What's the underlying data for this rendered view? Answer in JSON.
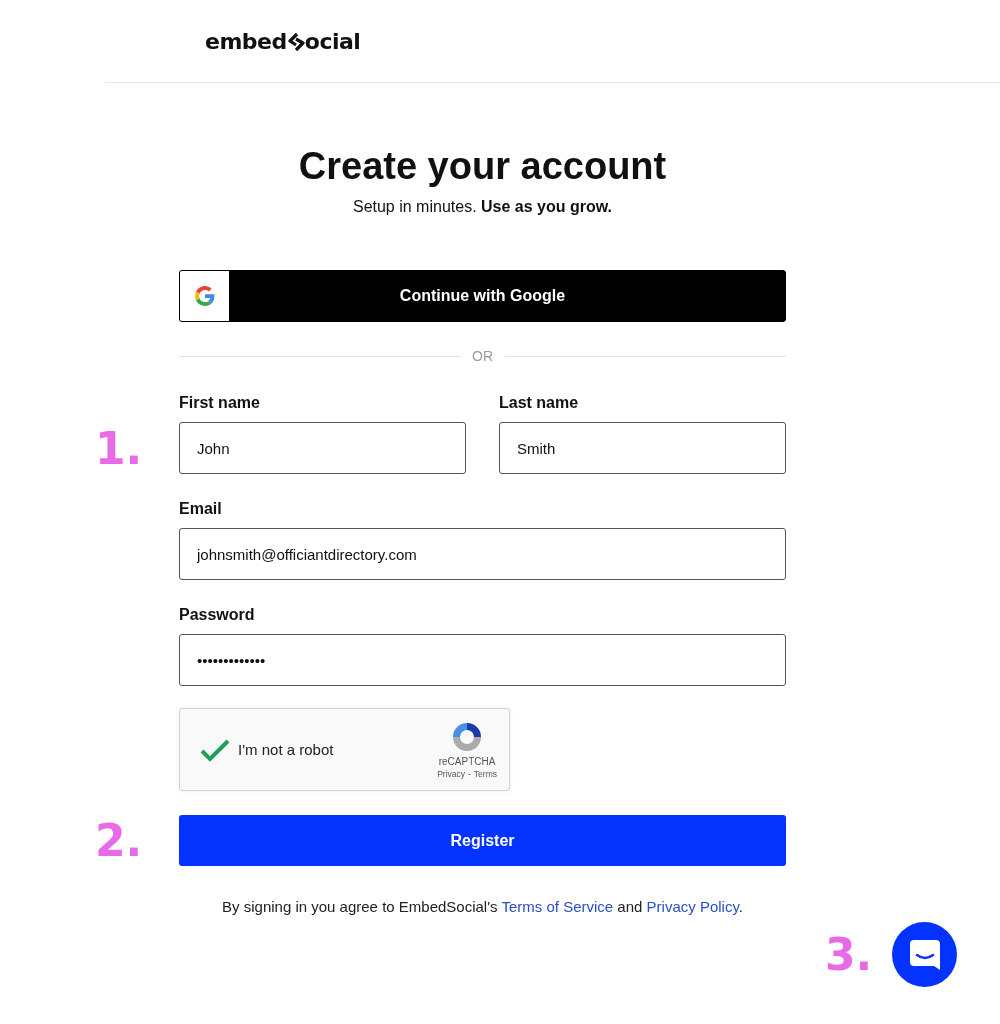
{
  "logo": {
    "before": "embed",
    "after": "ocial"
  },
  "title": "Create your account",
  "subtitle": "Setup in minutes. **Use as you grow.**",
  "google_button": "Continue with Google",
  "divider": "OR",
  "fields": [
    {
      "label": "First name",
      "value": "John"
    },
    {
      "label": "Last name",
      "value": "Smith"
    },
    {
      "label": "Email",
      "value": "johnsmith@officiantdirectory.com"
    },
    {
      "label": "Password",
      "value": "•••••••••••••"
    }
  ],
  "captcha": {
    "label": "I'm not a robot",
    "checked": true,
    "brand": "reCAPTCHA",
    "privacy": "Privacy",
    "separator": "-",
    "terms": "Terms"
  },
  "register_button": "Register",
  "footer": {
    "text": "By signing in you agree to EmbedSocial's",
    "terms_link": "Terms of Service",
    "joiner": "and",
    "privacy_link": "Privacy Policy",
    "end": "."
  },
  "annotations": [
    "1.",
    "2.",
    "3."
  ]
}
